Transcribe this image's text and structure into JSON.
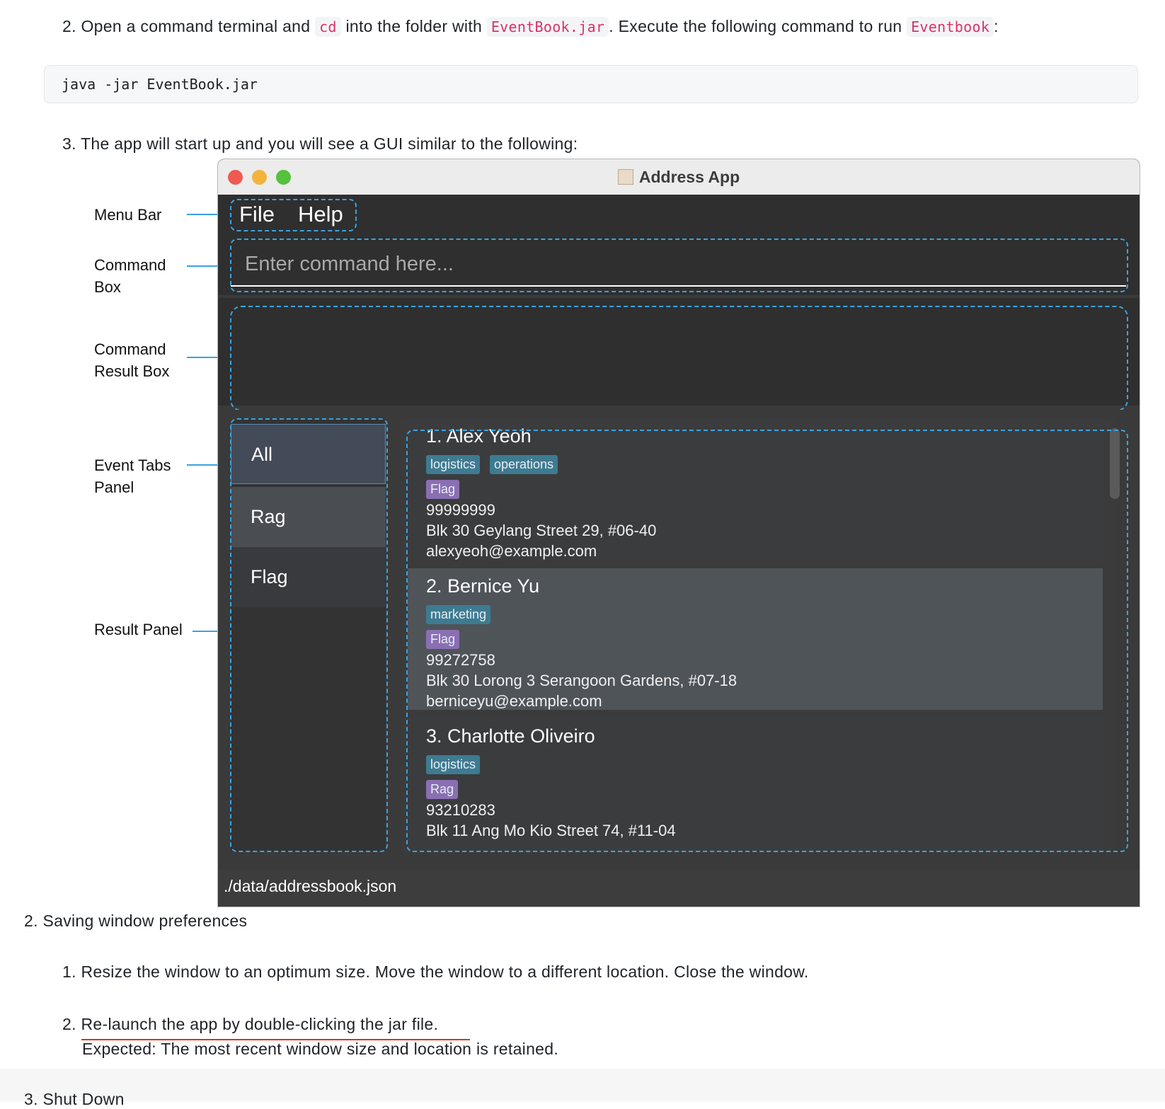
{
  "step2": {
    "prefix": "2. Open a command terminal and",
    "code1": "cd",
    "middle": "into the folder with",
    "code2": "EventBook.jar",
    "suffix": ". Execute the following command to run",
    "code3": "Eventbook",
    "end": ":"
  },
  "code_block": "java -jar EventBook.jar",
  "step3": "3. The app will start up and you will see a GUI similar to the following:",
  "annotations": {
    "menu_bar": "Menu Bar",
    "command_box_1": "Command",
    "command_box_2": "Box",
    "result_box_1": "Command",
    "result_box_2": "Result Box",
    "event_tabs_1": "Event Tabs",
    "event_tabs_2": "Panel",
    "result_panel": "Result Panel"
  },
  "window": {
    "title": "Address App",
    "menu": [
      "File",
      "Help"
    ],
    "command_placeholder": "Enter command here...",
    "tabs": [
      "All",
      "Rag",
      "Flag"
    ],
    "status": "./data/addressbook.json"
  },
  "persons": [
    {
      "name": "1.  Alex Yeoh",
      "tags": [
        "logistics",
        "operations"
      ],
      "category": "Flag",
      "phone": "99999999",
      "address": "Blk 30 Geylang Street 29, #06-40",
      "email": "alexyeoh@example.com"
    },
    {
      "name": "2.  Bernice Yu",
      "tags": [
        "marketing"
      ],
      "category": "Flag",
      "phone": "99272758",
      "address": "Blk 30 Lorong 3 Serangoon Gardens, #07-18",
      "email": "berniceyu@example.com"
    },
    {
      "name": "3.  Charlotte Oliveiro",
      "tags": [
        "logistics"
      ],
      "category": "Rag",
      "phone": "93210283",
      "address": "Blk 11 Ang Mo Kio Street 74, #11-04"
    }
  ],
  "section2": {
    "heading": "2. Saving window preferences",
    "item1": "1. Resize the window to an optimum size. Move the window to a different location. Close the window.",
    "item2_num": "2.",
    "item2_text": "Re-launch the app by double-clicking the jar file.",
    "item2_expected": "Expected: The most recent window size and location is retained."
  },
  "section3": {
    "heading": "3. Shut Down"
  },
  "colors": {
    "accent_dashed": "#3aa3e0",
    "inline_code": "#d6336c",
    "tag_blue": "#3e7b91",
    "tag_purple": "#8a6fb2",
    "underline_red": "#e0301e"
  }
}
